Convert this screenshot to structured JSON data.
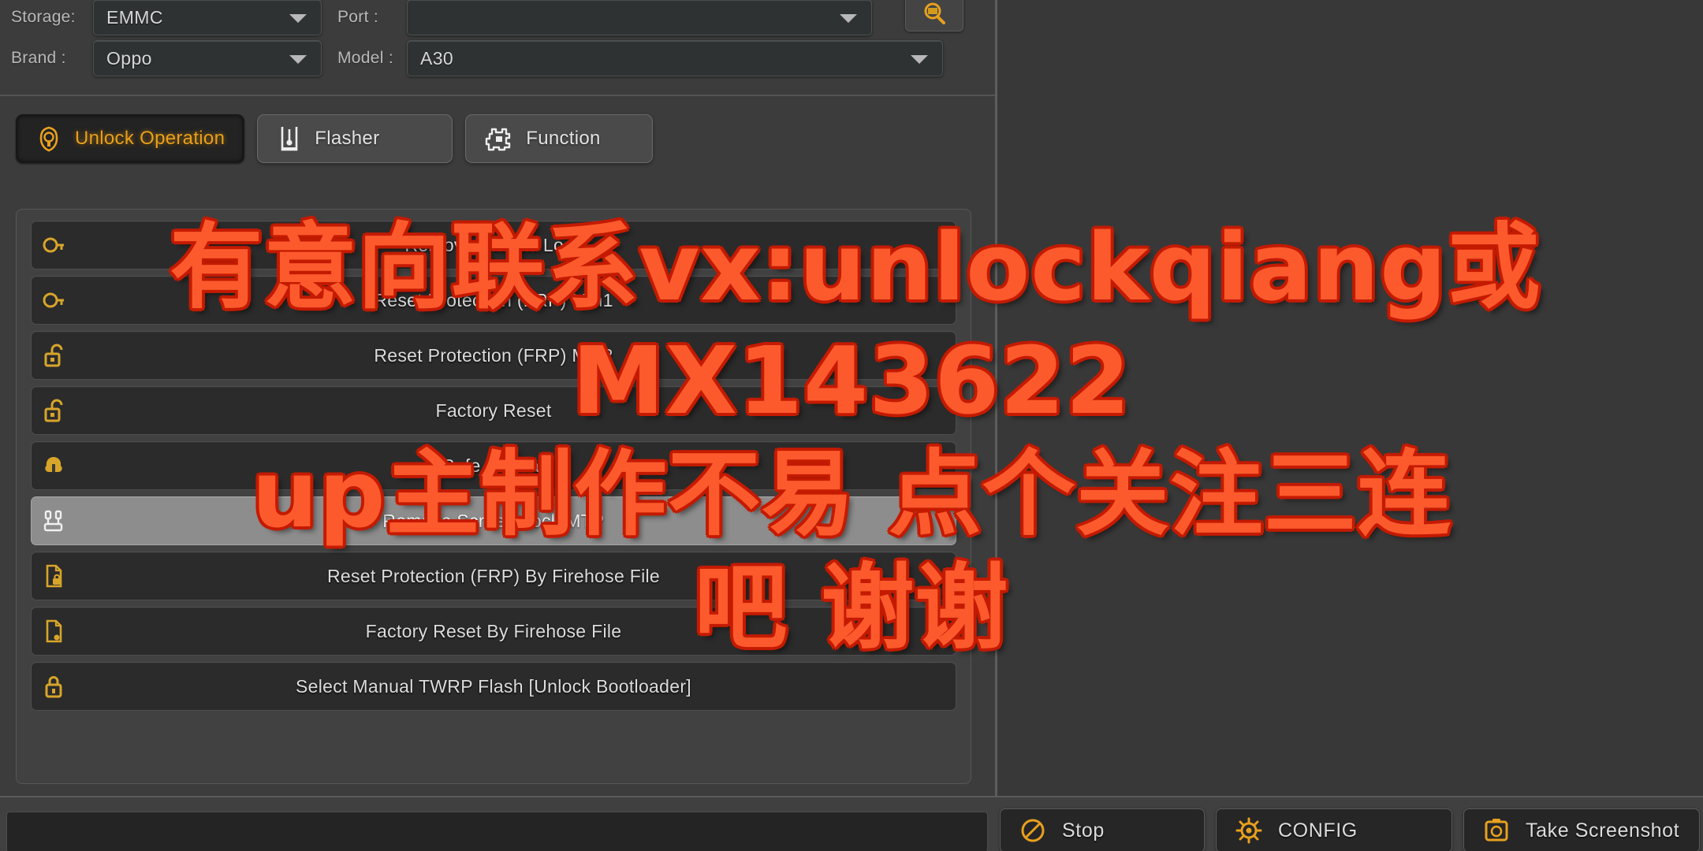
{
  "form": {
    "storage": {
      "label": "Storage:",
      "value": "EMMC"
    },
    "port": {
      "label": "Port :",
      "value": ""
    },
    "brand": {
      "label": "Brand :",
      "value": "Oppo"
    },
    "model": {
      "label": "Model :",
      "value": "A30"
    },
    "search_icon": "magnifier-icon"
  },
  "tabs": [
    {
      "label": "Unlock Operation",
      "icon": "unlock-shield-icon",
      "active": true
    },
    {
      "label": "Flasher",
      "icon": "flash-tool-icon",
      "active": false
    },
    {
      "label": "Function",
      "icon": "function-chip-icon",
      "active": false
    }
  ],
  "operations": [
    {
      "label": "Remove Screen Lock",
      "icon": "key-ring-icon",
      "highlight": false
    },
    {
      "label": "Reset Protection (FRP) Mth1",
      "icon": "key-ring-icon",
      "highlight": false
    },
    {
      "label": "Reset Protection (FRP) Mth2",
      "icon": "open-lock-icon",
      "highlight": false
    },
    {
      "label": "Factory Reset",
      "icon": "open-lock-icon",
      "highlight": false
    },
    {
      "label": "Safe Format",
      "icon": "format-icon",
      "highlight": false
    },
    {
      "label": "Remove Screen Lock MTP",
      "icon": "usb-cable-icon",
      "highlight": true
    },
    {
      "label": "Reset Protection (FRP) By Firehose File",
      "icon": "file-lock-icon",
      "highlight": false
    },
    {
      "label": "Factory Reset By Firehose File",
      "icon": "file-icon",
      "highlight": false
    },
    {
      "label": "Select Manual TWRP Flash [Unlock Bootloader]",
      "icon": "padlock-icon",
      "highlight": false
    }
  ],
  "bottom": {
    "status_value": "",
    "buttons": [
      {
        "label": "Stop",
        "icon": "stop-icon"
      },
      {
        "label": "CONFIG",
        "icon": "gear-icon"
      },
      {
        "label": "Take Screenshot",
        "icon": "camera-icon"
      }
    ]
  },
  "watermark": {
    "line1": "有意向联系vx:unlockqiang或",
    "line2": "MX143622",
    "line3": "up主制作不易 点个关注三连",
    "line4": "吧 谢谢",
    "color": "#fc5a2d"
  }
}
